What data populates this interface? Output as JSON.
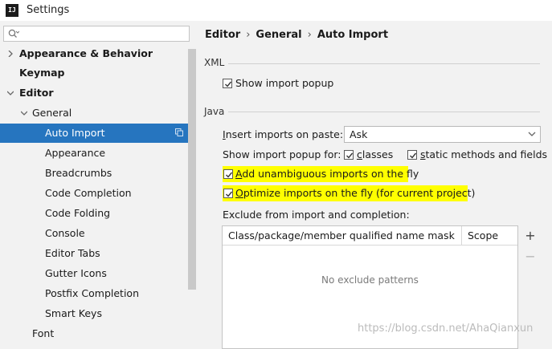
{
  "window": {
    "app_icon_text": "IJ",
    "title": "Settings"
  },
  "sidebar": {
    "search": {
      "value": "",
      "placeholder": ""
    },
    "items": [
      {
        "label": "Appearance & Behavior",
        "level": 0,
        "expanded": false,
        "bold": true,
        "selected": false
      },
      {
        "label": "Keymap",
        "level": 0,
        "bold": true,
        "selected": false
      },
      {
        "label": "Editor",
        "level": 0,
        "expanded": true,
        "bold": true,
        "selected": false
      },
      {
        "label": "General",
        "level": 1,
        "expanded": true,
        "bold": false,
        "selected": false
      },
      {
        "label": "Auto Import",
        "level": 2,
        "bold": false,
        "selected": true
      },
      {
        "label": "Appearance",
        "level": 2,
        "bold": false,
        "selected": false
      },
      {
        "label": "Breadcrumbs",
        "level": 2,
        "bold": false,
        "selected": false
      },
      {
        "label": "Code Completion",
        "level": 2,
        "bold": false,
        "selected": false
      },
      {
        "label": "Code Folding",
        "level": 2,
        "bold": false,
        "selected": false
      },
      {
        "label": "Console",
        "level": 2,
        "bold": false,
        "selected": false
      },
      {
        "label": "Editor Tabs",
        "level": 2,
        "bold": false,
        "selected": false
      },
      {
        "label": "Gutter Icons",
        "level": 2,
        "bold": false,
        "selected": false
      },
      {
        "label": "Postfix Completion",
        "level": 2,
        "bold": false,
        "selected": false
      },
      {
        "label": "Smart Keys",
        "level": 2,
        "bold": false,
        "selected": false
      },
      {
        "label": "Font",
        "level": 1,
        "bold": false,
        "selected": false
      }
    ]
  },
  "breadcrumb": {
    "items": [
      "Editor",
      "General",
      "Auto Import"
    ],
    "separator": "›"
  },
  "xml": {
    "header": "XML",
    "show_import_popup": {
      "label": "Show import popup",
      "checked": true
    }
  },
  "java": {
    "header": "Java",
    "insert_on_paste": {
      "label_u": "I",
      "label_rest": "nsert imports on paste:",
      "value": "Ask"
    },
    "show_popup_for": {
      "label": "Show import popup for:",
      "classes": {
        "label_u": "c",
        "label_rest": "lasses",
        "checked": true
      },
      "static": {
        "label_u": "s",
        "label_rest": "tatic methods and fields",
        "checked": true
      }
    },
    "add_unambiguous": {
      "label_u": "A",
      "label_rest": "dd unambiguous imports on the fly",
      "checked": true,
      "highlight": "#ffff00"
    },
    "optimize_imports": {
      "label_u": "O",
      "label_rest": "ptimize imports on the fly (for current project)",
      "checked": true,
      "highlight": "#ffff00"
    },
    "exclude": {
      "label": "Exclude from import and completion:",
      "columns": [
        "Class/package/member qualified name mask",
        "Scope"
      ],
      "empty_text": "No exclude patterns",
      "add_symbol": "+",
      "remove_symbol": "−"
    }
  },
  "watermark": "https://blog.csdn.net/AhaQianxun",
  "colors": {
    "selection": "#2675bf",
    "highlight": "#ffff00",
    "background": "#f2f2f2"
  }
}
